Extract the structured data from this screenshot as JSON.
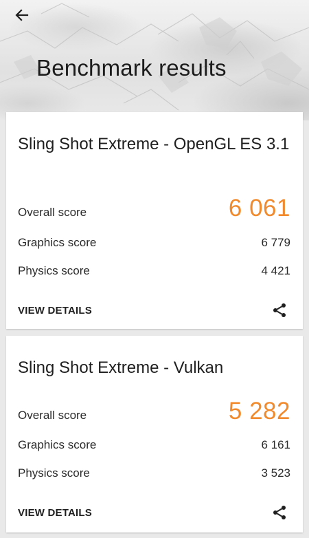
{
  "page": {
    "title": "Benchmark results",
    "accent_color": "#f08a2c",
    "icons": {
      "back": "arrow-back-icon",
      "share": "share-icon"
    }
  },
  "results": [
    {
      "name": "Sling Shot Extreme - OpenGL ES 3.1",
      "overall_label": "Overall score",
      "overall_value": "6 061",
      "graphics_label": "Graphics score",
      "graphics_value": "6 779",
      "physics_label": "Physics score",
      "physics_value": "4 421",
      "details_label": "VIEW DETAILS"
    },
    {
      "name": "Sling Shot Extreme - Vulkan",
      "overall_label": "Overall score",
      "overall_value": "5 282",
      "graphics_label": "Graphics score",
      "graphics_value": "6 161",
      "physics_label": "Physics score",
      "physics_value": "3 523",
      "details_label": "VIEW DETAILS"
    }
  ]
}
